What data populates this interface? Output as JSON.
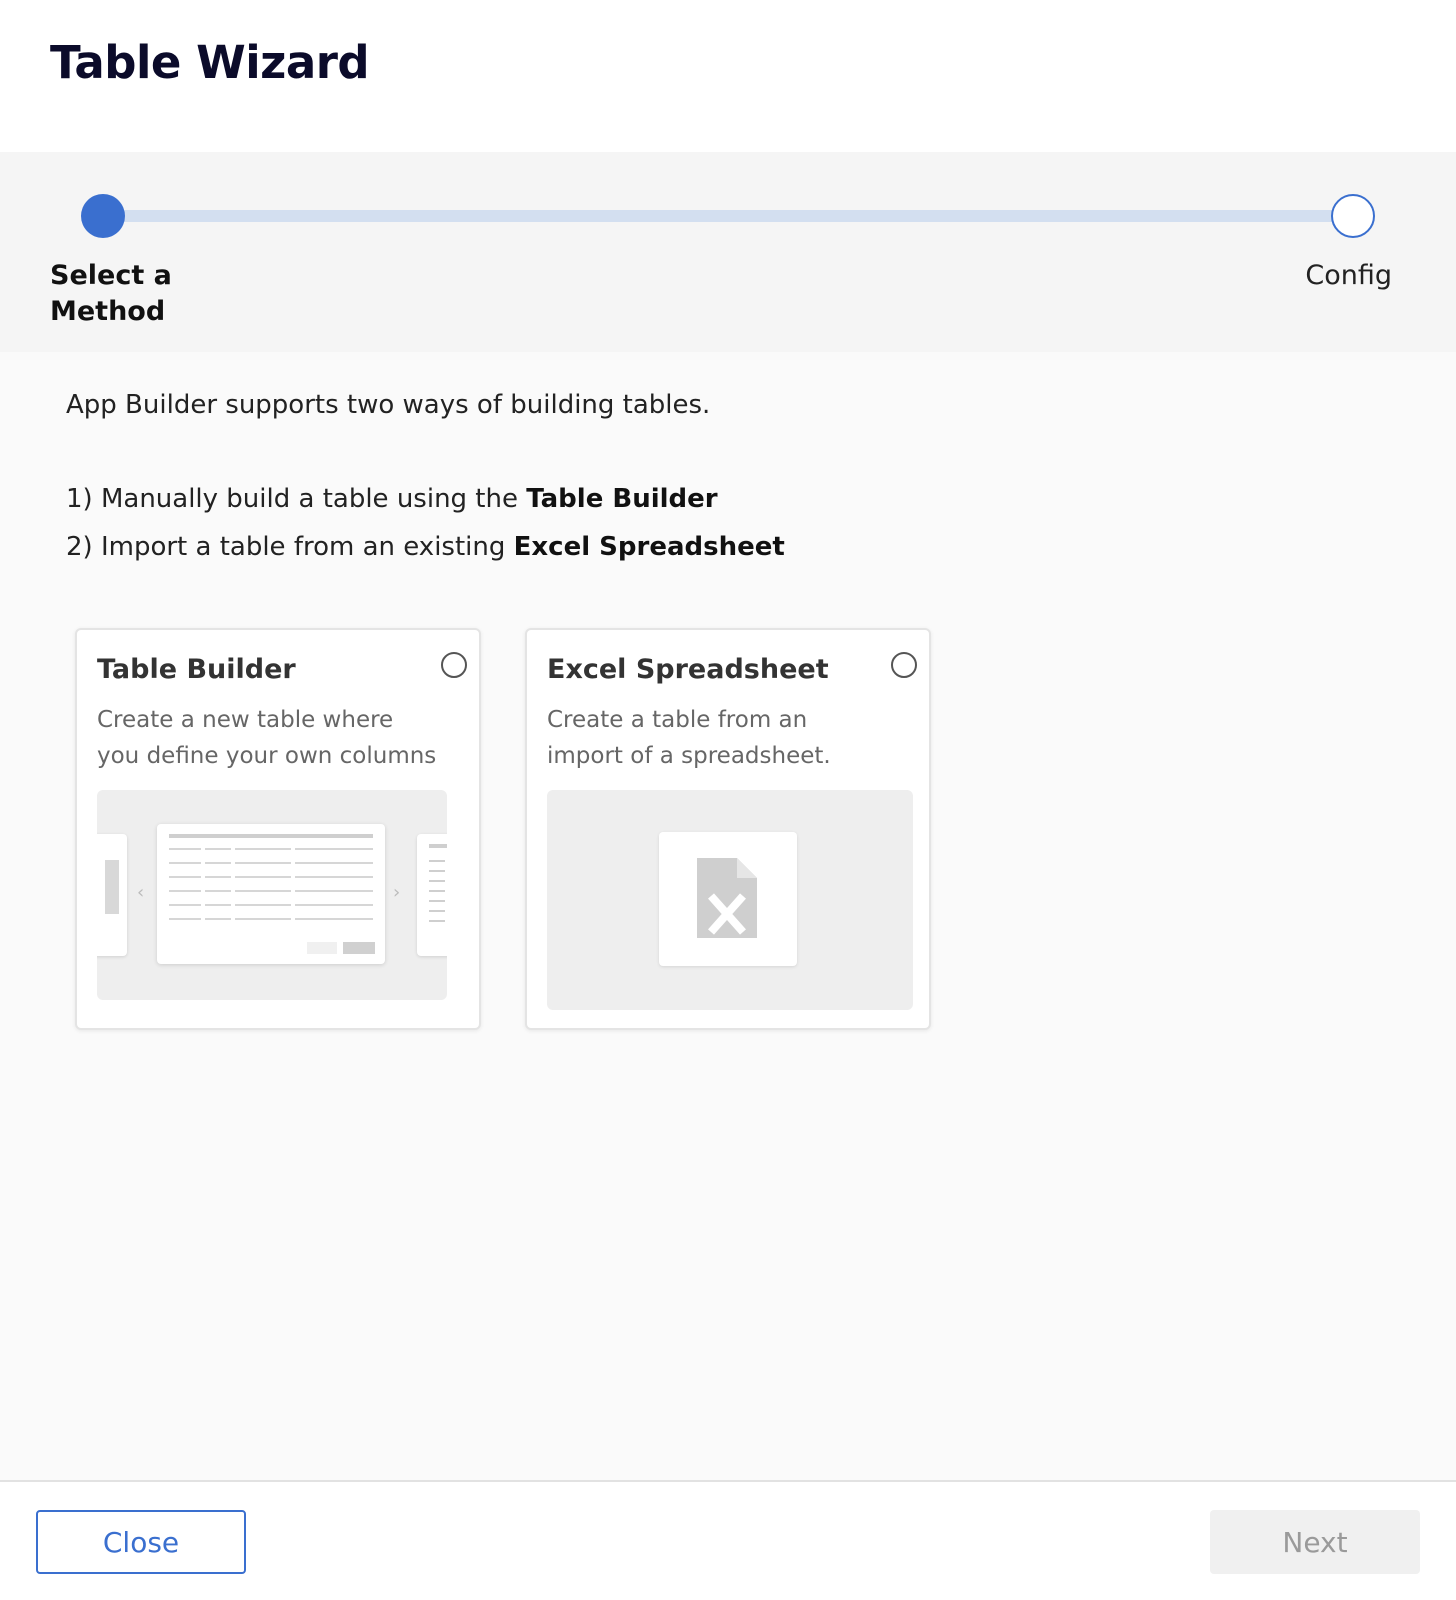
{
  "header": {
    "title": "Table Wizard"
  },
  "stepper": {
    "steps": [
      {
        "label": "Select a Method",
        "state": "active"
      },
      {
        "label": "Config",
        "state": "inactive"
      }
    ],
    "accent_color": "#3a6fcf"
  },
  "main": {
    "intro": "App Builder supports two ways of building tables.",
    "options": [
      {
        "prefix": "1) Manually build a table using the ",
        "emphasis": "Table Builder"
      },
      {
        "prefix": "2) Import a table from an existing ",
        "emphasis": "Excel Spreadsheet"
      }
    ],
    "cards": [
      {
        "title": "Table Builder",
        "description": "Create a new table where you define your own columns",
        "selected": false,
        "preview_icon": "table-preview-illustration"
      },
      {
        "title": "Excel Spreadsheet",
        "description": "Create a table from an import of a spreadsheet.",
        "selected": false,
        "preview_icon": "excel-file-icon"
      }
    ]
  },
  "footer": {
    "close_label": "Close",
    "next_label": "Next",
    "next_enabled": false
  }
}
